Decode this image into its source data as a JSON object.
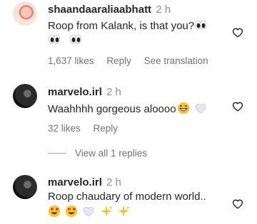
{
  "comments": [
    {
      "username": "shaandaaraliaabhatt",
      "time": "2 h",
      "text_line1": "Roop from Kalank, is that you?",
      "likes": "1,637 likes",
      "reply": "Reply",
      "translate": "See translation"
    },
    {
      "username": "marvelo.irl",
      "time": "2 h",
      "text_line1": "Waahhhh gorgeous aloooo",
      "likes": "32 likes",
      "reply": "Reply"
    },
    {
      "username": "marvelo.irl",
      "time": "2 h",
      "text_line1": "Roop chaudary of modern world.."
    }
  ],
  "view_replies": "View all 1 replies",
  "icons": {
    "like": "heart-outline-icon",
    "eyes": "eyes-emoji",
    "grin": "grinning-emoji",
    "heart_white": "white-heart-emoji",
    "heart_eyes": "heart-eyes-emoji",
    "sparkles": "sparkles-emoji"
  }
}
